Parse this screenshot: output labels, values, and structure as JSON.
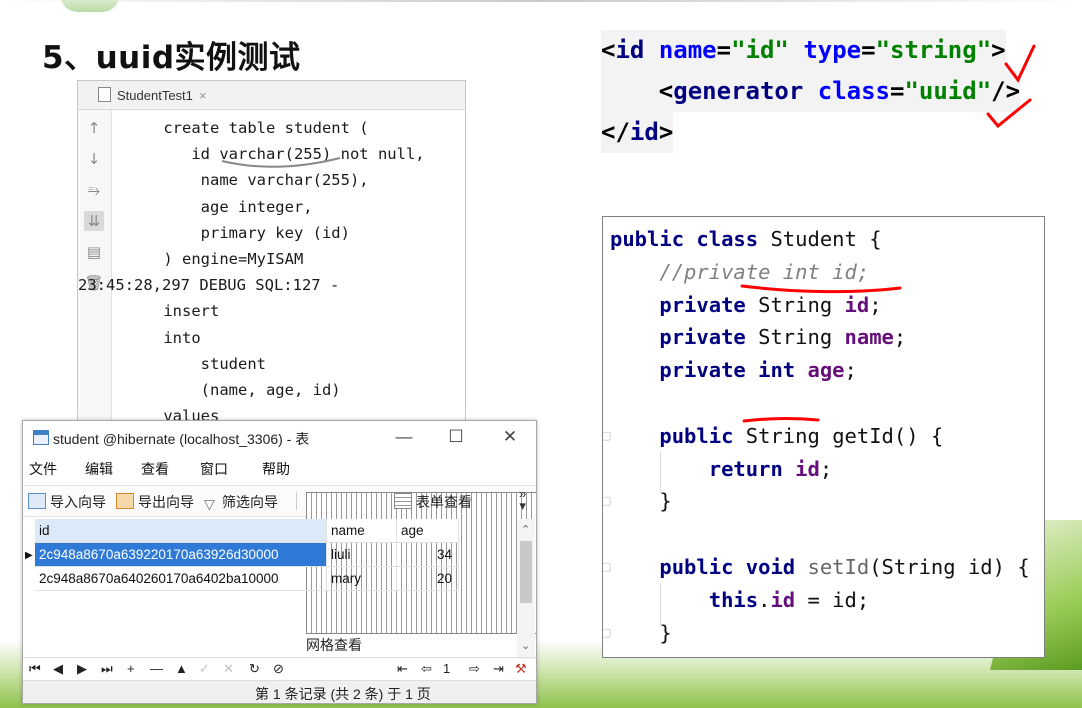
{
  "slide": {
    "title": "5、uuid实例测试"
  },
  "ide": {
    "tab_label": "StudentTest1",
    "tab_close": "×",
    "gutter_icons": [
      "up-arrow-icon",
      "down-arrow-icon",
      "wrap-icon",
      "scroll-icon",
      "print-icon",
      "trash-icon"
    ],
    "lines": [
      "    create table student (",
      "       id varchar(255) not null,",
      "        name varchar(255),",
      "        age integer,",
      "        primary key (id)",
      "    ) engine=MyISAM",
      "23:45:28,297 DEBUG SQL:127 -",
      "    insert",
      "    into",
      "        student",
      "        (name, age, id)",
      "    values"
    ]
  },
  "db_window": {
    "title": "student @hibernate (localhost_3306) - 表",
    "controls": {
      "minimize": "—",
      "maximize": "☐",
      "close": "✕"
    },
    "menu": [
      "文件",
      "编辑",
      "查看",
      "窗口",
      "帮助"
    ],
    "toolbar": [
      "导入向导",
      "导出向导",
      "筛选向导",
      "网格查看",
      "表单查看"
    ],
    "toolbar_more": "»",
    "columns": [
      "id",
      "name",
      "age"
    ],
    "rows": [
      {
        "id": "2c948a8670a639220170a63926d30000",
        "name": "liuli",
        "age": "34"
      },
      {
        "id": "2c948a8670a640260170a6402ba10000",
        "name": "mary",
        "age": "20"
      }
    ],
    "nav": {
      "first": "⏮",
      "prev": "◀",
      "next": "▶",
      "last": "⏭",
      "add": "+",
      "remove": "—",
      "up": "▲",
      "confirm": "✓",
      "cancel": "✕",
      "refresh": "↻",
      "stop": "⊘",
      "page_first": "⇤",
      "page_prev": "⇦",
      "page_num": "1",
      "page_next": "⇨",
      "page_last": "⇥",
      "settings": "⚒"
    },
    "status": "第 1 条记录 (共 2 条) 于 1 页"
  },
  "xml_snippet": {
    "line1": {
      "open": "<",
      "tag": "id",
      "attr1": "name",
      "val1": "\"id\"",
      "attr2": "type",
      "val2": "\"string\"",
      "close": ">"
    },
    "line2": {
      "open": "<",
      "tag": "generator",
      "attr": "class",
      "val": "\"uuid\"",
      "close": "/>"
    },
    "line3": {
      "open": "</",
      "tag": "id",
      "close": ">"
    }
  },
  "java_snippet": {
    "kw_public": "public",
    "kw_class": "class",
    "class_name": "Student",
    "brace_open": "{",
    "comment": "//private int id;",
    "kw_private": "private",
    "type_string": "String",
    "kw_int": "int",
    "field_id": "id",
    "field_name": "name",
    "field_age": "age",
    "semi": ";",
    "getter_sig": "getId() {",
    "kw_return": "return",
    "brace_close": "}",
    "kw_void": "void",
    "setter_name": "setId",
    "setter_params": "(String id) {",
    "kw_this": "this",
    "assign": "= id;"
  },
  "annotation_color": "#ff0000"
}
